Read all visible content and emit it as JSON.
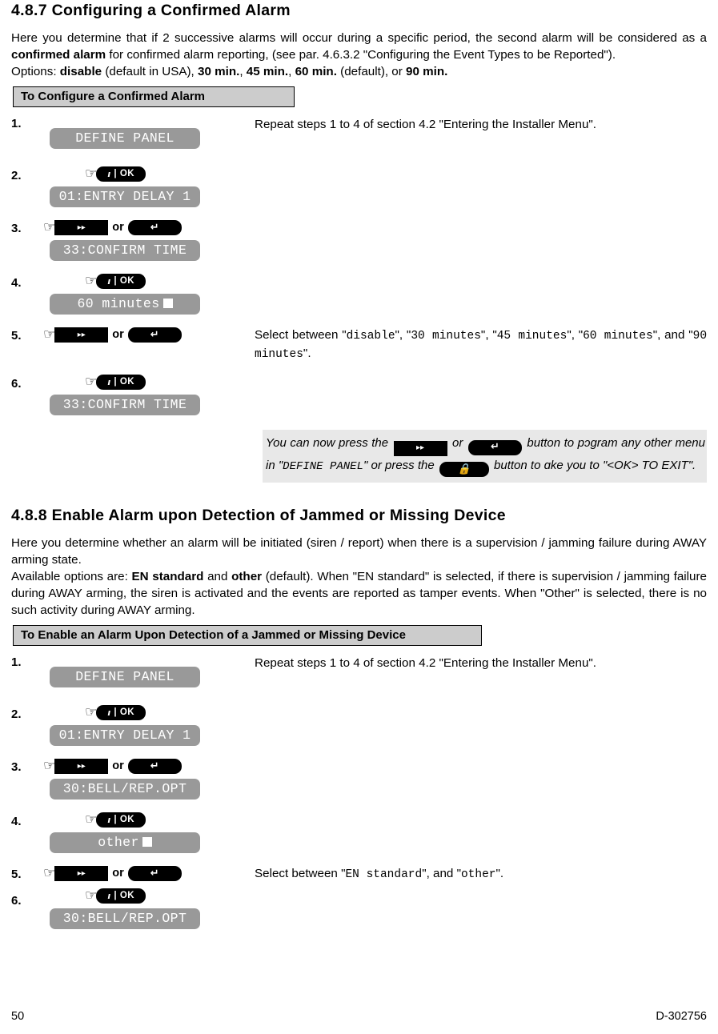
{
  "document": {
    "footer": {
      "page_number": "50",
      "doc_code": "D-302756"
    }
  },
  "section_487": {
    "heading": "4.8.7 Configuring a Confirmed Alarm",
    "intro_1a": "Here you determine that if 2 successive alarms will occur during a specific period, the second alarm will be considered as a ",
    "intro_1b": "confirmed alarm",
    "intro_1c": " for confirmed alarm reporting, (see par. 4.6.3.2 \"Configuring the Event Types to be Reported\").",
    "options_prefix": "Options: ",
    "options_1": "disable",
    "options_1_note": " (default in USA), ",
    "options_2": "30 min.",
    "options_sep_2": ", ",
    "options_3": "45 min.",
    "options_sep_3": ", ",
    "options_4": "60 min.",
    "options_4_note": " (default), or ",
    "options_5": "90 min.",
    "banner": "To Configure a Confirmed Alarm",
    "steps": [
      {
        "num": "1.",
        "lcd": "DEFINE PANEL",
        "right": "Repeat steps 1 to 4 of section 4.2 \"Entering the Installer Menu\"."
      },
      {
        "num": "2.",
        "lcd": "01:ENTRY DELAY 1",
        "right": ""
      },
      {
        "num": "3.",
        "lcd": "33:CONFIRM TIME",
        "right": ""
      },
      {
        "num": "4.",
        "lcd": "60 minutes",
        "cursor": true,
        "right": ""
      },
      {
        "num": "5.",
        "lcd": "",
        "right": ""
      },
      {
        "num": "6.",
        "lcd": "33:CONFIRM TIME",
        "right": ""
      }
    ],
    "step5_right": {
      "lead": "Select between \"",
      "opt1": "disable",
      "mid1": "\", \"",
      "opt2": "30 minutes",
      "mid2": "\", \"",
      "opt3": "45 minutes",
      "mid3": "\", \"",
      "opt4": "60 minutes",
      "mid4": "\", and \"",
      "opt5": "90 minutes",
      "tail": "\"."
    },
    "note": {
      "t1": "You can now press the ",
      "t2": " or ",
      "t3": " button to p",
      "t3b": "ɔgram any other menu in \"",
      "t4": "DEFINE PANEL",
      "t5": "\" or press the ",
      "t6": " button to ",
      "t6b": "ɑke you to \"<OK> TO EXIT\"."
    }
  },
  "section_488": {
    "heading": "4.8.8 Enable Alarm upon Detection of Jammed or Missing Device",
    "intro_1": "Here you determine whether an alarm will be initiated (siren / report) when there is a supervision / jamming failure during AWAY arming state.",
    "intro_2a": "Available options are: ",
    "intro_2b": "EN standard",
    "intro_2c": " and ",
    "intro_2d": "other",
    "intro_2e": " (default). When \"EN standard\" is selected, if there is supervision / jamming failure during AWAY arming, the siren is activated and the events are reported as tamper events. When \"Other\" is selected, there is no such activity during AWAY arming.",
    "banner": "To Enable an Alarm Upon Detection of a Jammed or Missing Device",
    "steps": [
      {
        "num": "1.",
        "lcd": "DEFINE PANEL",
        "right": "Repeat steps 1 to 4 of section 4.2 \"Entering the Installer Menu\"."
      },
      {
        "num": "2.",
        "lcd": "01:ENTRY DELAY 1",
        "right": ""
      },
      {
        "num": "3.",
        "lcd": "30:BELL/REP.OPT",
        "right": ""
      },
      {
        "num": "4.",
        "lcd": "other",
        "cursor": true,
        "right": ""
      },
      {
        "num": "5.",
        "lcd": "",
        "right": ""
      },
      {
        "num": "6.",
        "lcd": "30:BELL/REP.OPT",
        "right": ""
      }
    ],
    "step5_right": {
      "lead": "Select between \"",
      "opt1": "EN standard",
      "mid1": "\", and \"",
      "opt2": "other",
      "tail": "\"."
    }
  },
  "buttons": {
    "ok_label": "OK",
    "ok_info_glyph": "ı",
    "ok_sep": "|",
    "ff_glyph": "▸▸",
    "back_glyph": "↵",
    "lock_glyph": "🔒",
    "hand_glyph": "☞",
    "or_label": "or"
  }
}
